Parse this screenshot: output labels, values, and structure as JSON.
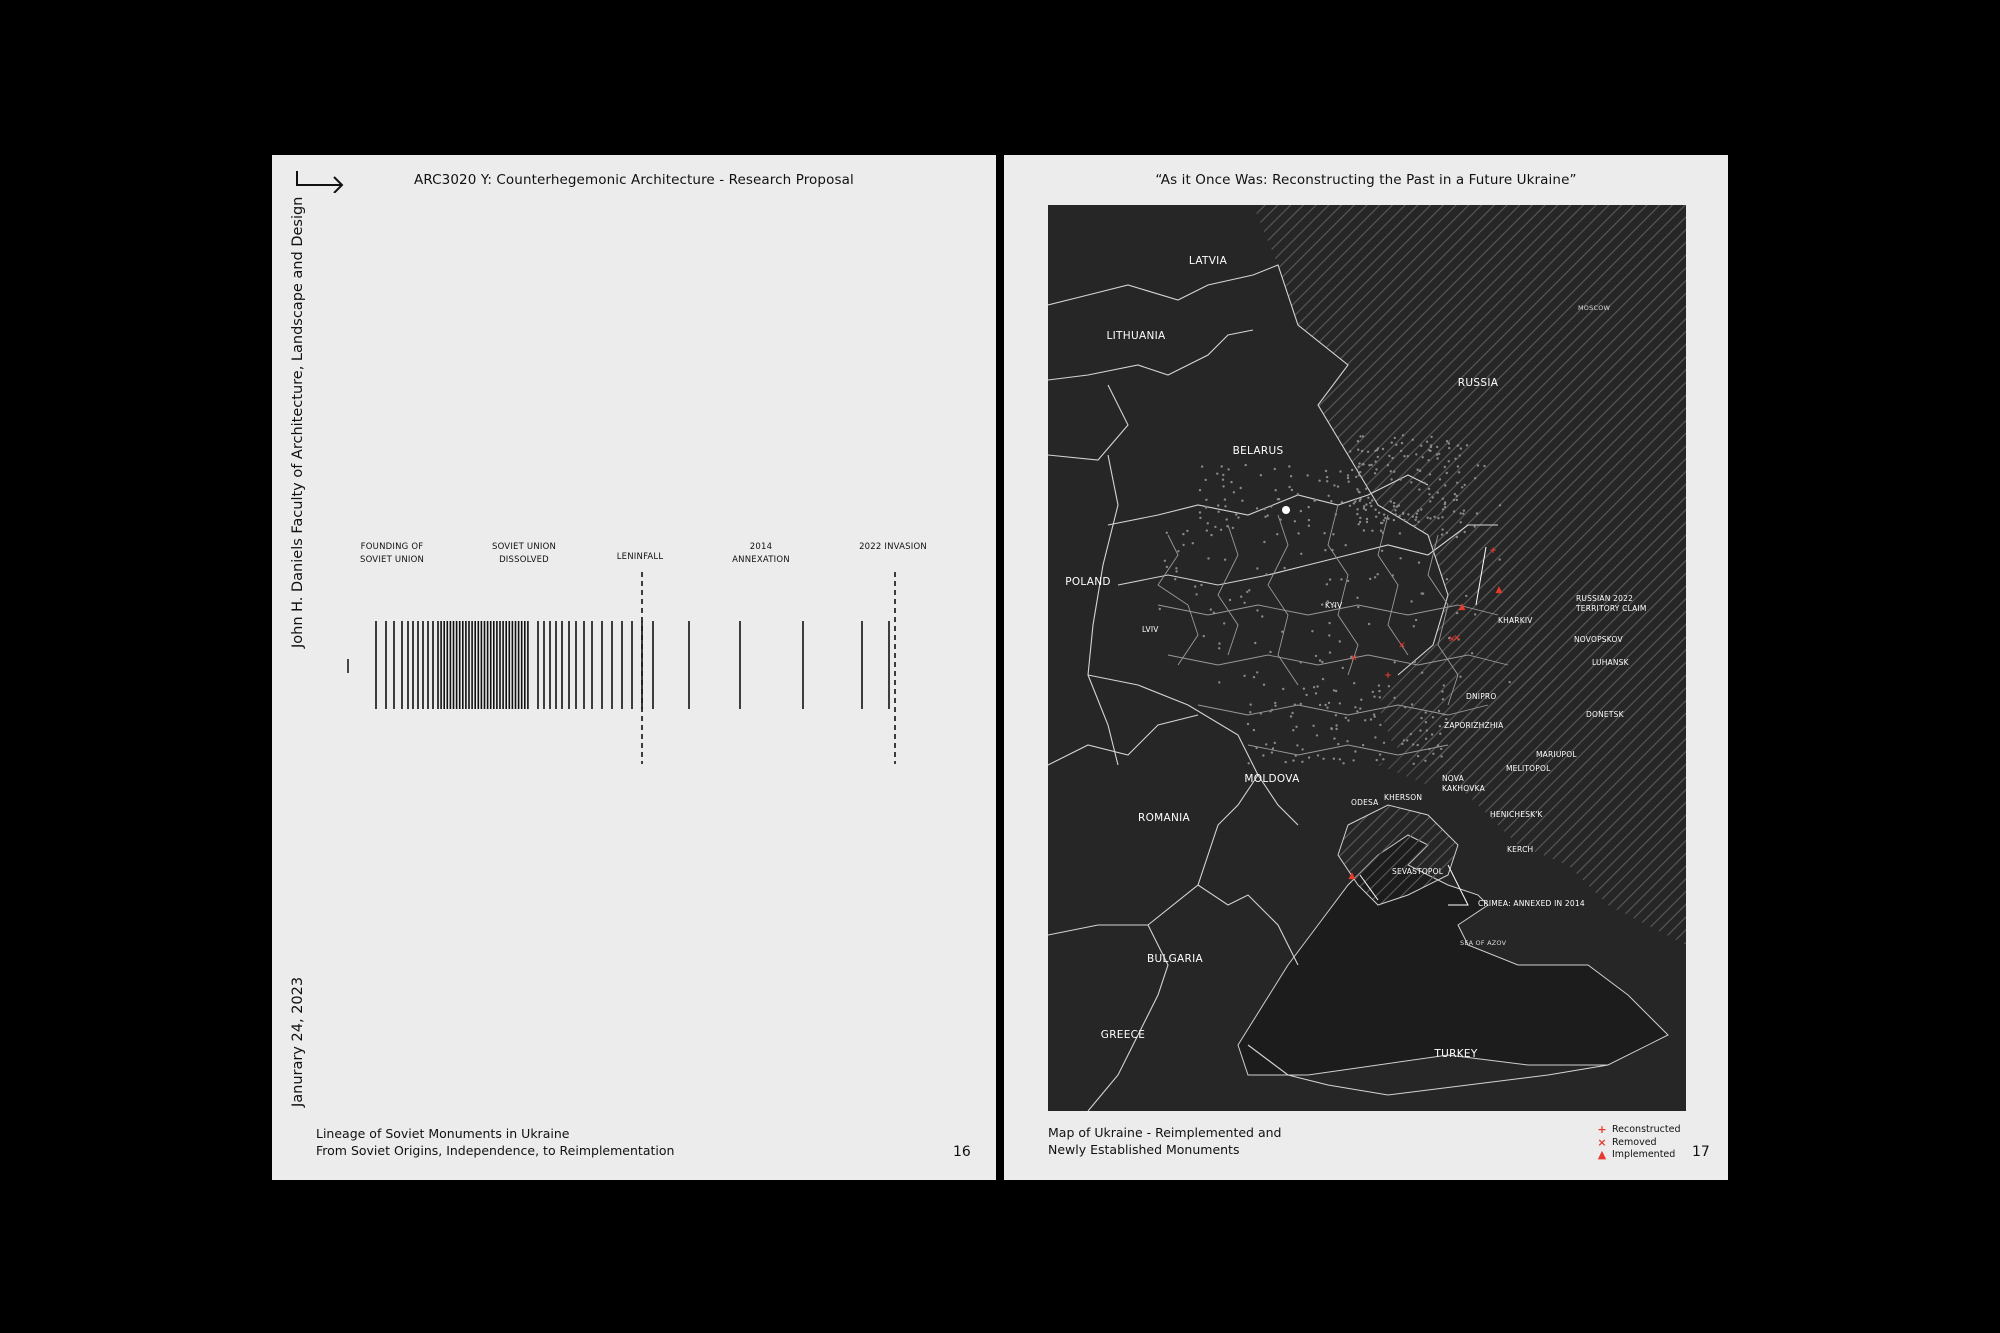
{
  "left_page": {
    "header": "ARC3020 Y: Counterhegemonic Architecture - Research Proposal",
    "side_text": "John H. Daniels Faculty of Architecture, Landscape and Design",
    "date": "Janurary 24, 2023",
    "footer_line1": "Lineage of Soviet Monuments in Ukraine",
    "footer_line2": "From Soviet Origins, Independence, to Reimplementation",
    "page_number": "16",
    "timeline_labels": {
      "founding_1": "FOUNDING OF",
      "founding_2": "SOVIET UNION",
      "dissolved_1": "SOVIET UNION",
      "dissolved_2": "DISSOLVED",
      "leninfall": "LENINFALL",
      "annex_1": "2014",
      "annex_2": "ANNEXATION",
      "invasion": "2022 INVASION"
    }
  },
  "right_page": {
    "header": "“As it Once Was: Reconstructing the Past in a Future Ukraine”",
    "footer_line1": "Map of Ukraine - Reimplemented and",
    "footer_line2": "Newly Established Monuments",
    "page_number": "17",
    "legend": {
      "reconstructed": "Reconstructed",
      "removed": "Removed",
      "implemented": "Implemented"
    },
    "map": {
      "countries": {
        "latvia": "LATVIA",
        "lithuania": "LITHUANIA",
        "russia": "RUSSIA",
        "belarus": "BELARUS",
        "poland": "POLAND",
        "moldova": "MOLDOVA",
        "romania": "ROMANIA",
        "bulgaria": "BULGARIA",
        "greece": "GREECE",
        "turkey": "TURKEY"
      },
      "cities": {
        "moscow": "MOSCOW",
        "kyiv": "KYIV",
        "lviv": "LVIV",
        "kharkiv": "KHARKIV",
        "novopskov": "NOVOPSKOV",
        "luhansk": "LUHANSK",
        "donetsk": "DONETSK",
        "dnipro": "DNIPRO",
        "zaporizhzhia": "ZAPORIZHZHIA",
        "mariupol": "MARIUPOL",
        "melitopol": "MELITOPOL",
        "nova_kakhovka_1": "NOVA",
        "nova_kakhovka_2": "KAKHOVKA",
        "kherson": "KHERSON",
        "odesa": "ODESA",
        "henichesk": "HENICHESK'K",
        "kerch": "KERCH",
        "sevastopol": "SEVASTOPOL",
        "sea_of_azov": "SEA OF AZOV"
      },
      "annotations": {
        "claim_1": "RUSSIAN 2022",
        "claim_2": "TERRITORY CLAIM",
        "crimea": "CRIMEA: ANNEXED IN 2014"
      }
    }
  },
  "colors": {
    "background": "#000000",
    "page": "#ececec",
    "map_bg": "#262626",
    "accent_red": "#e8392c"
  }
}
